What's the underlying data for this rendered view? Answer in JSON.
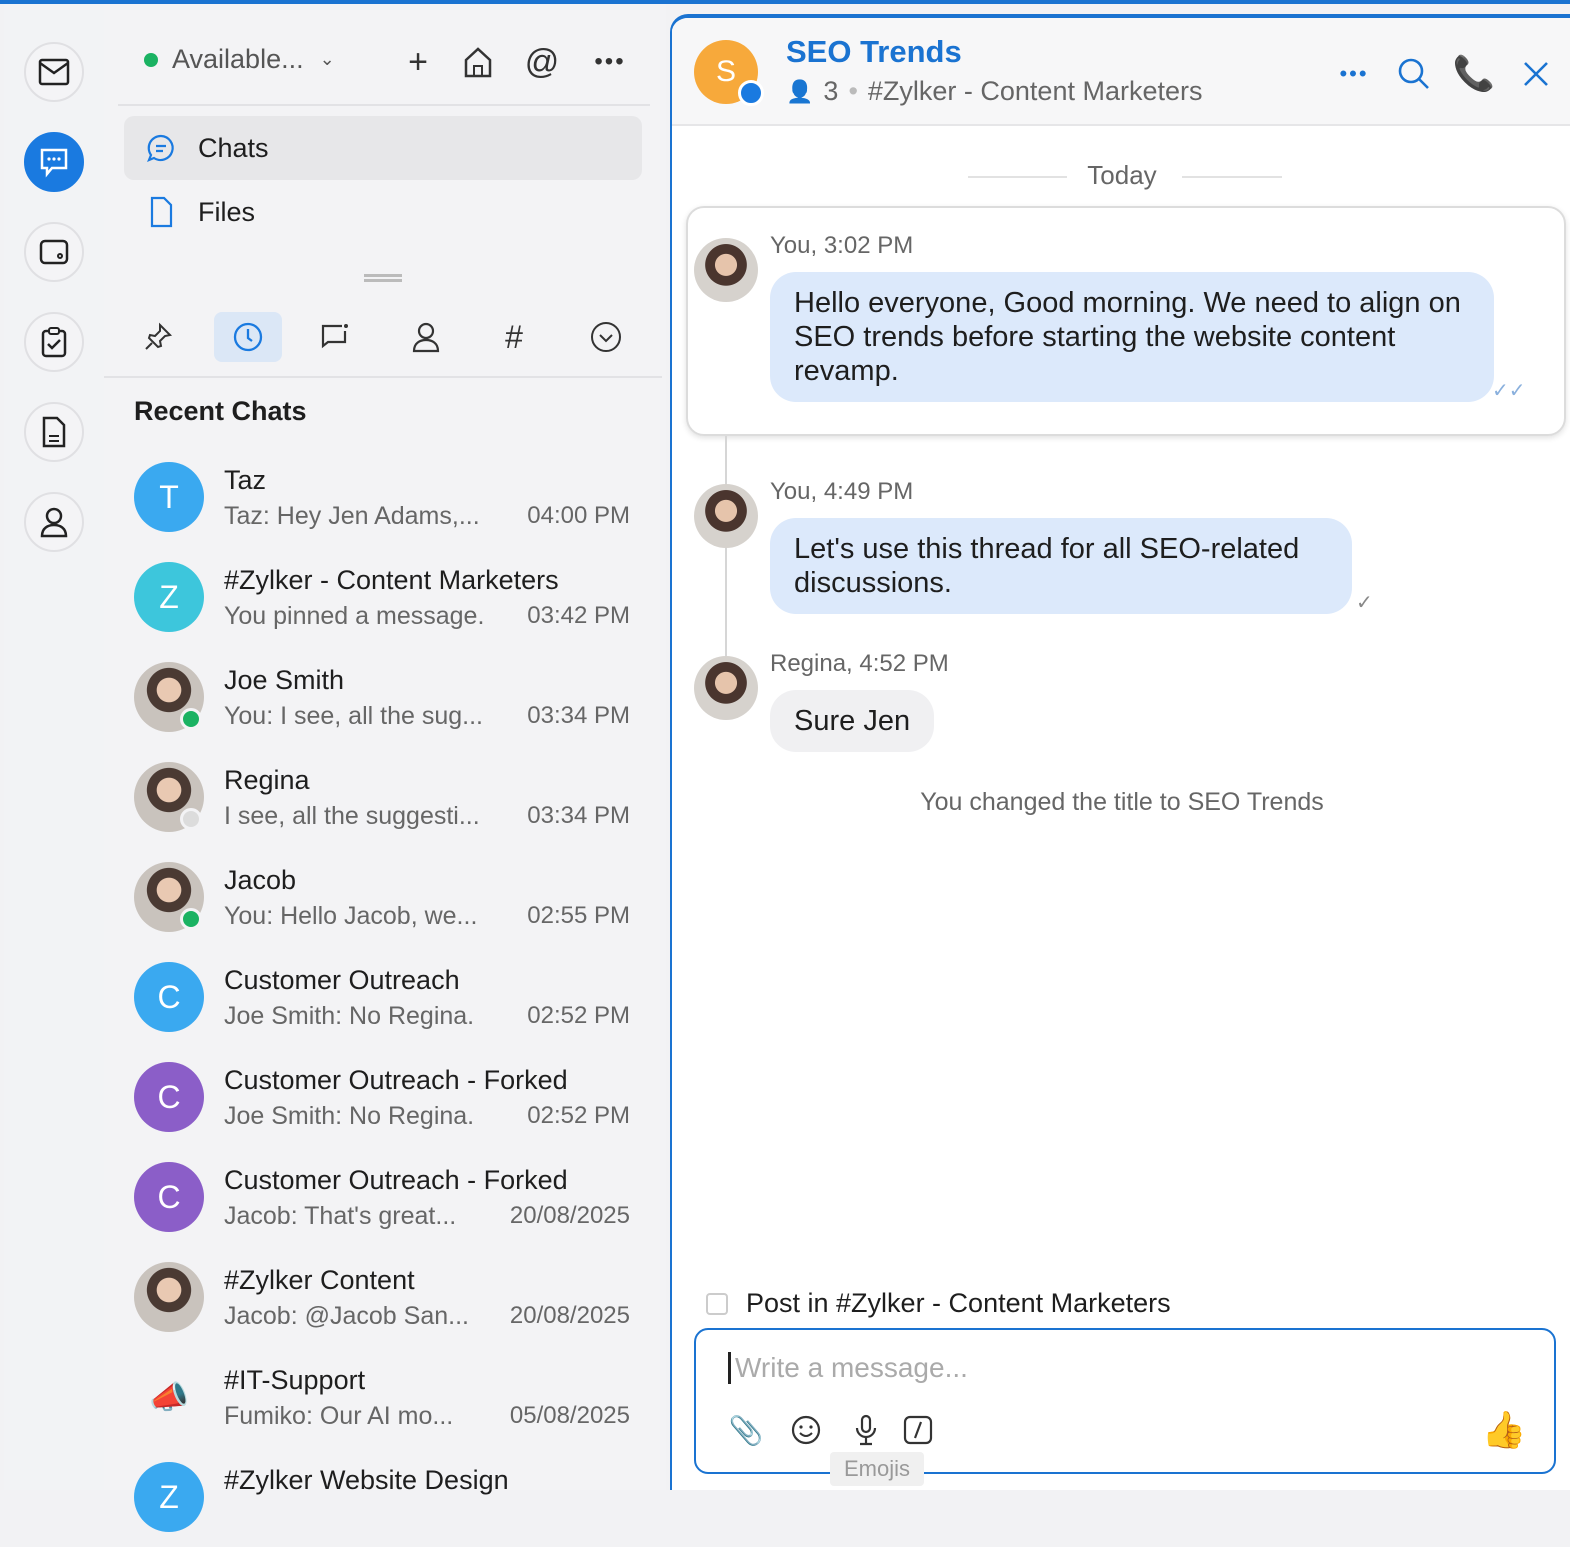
{
  "header": {
    "status": "Available..."
  },
  "nav": [
    {
      "label": "Chats"
    },
    {
      "label": "Files"
    }
  ],
  "recent_title": "Recent Chats",
  "chats": [
    {
      "initial": "T",
      "color": "#3aa9f0",
      "name": "Taz",
      "preview": "Taz: Hey Jen Adams,...",
      "time": "04:00 PM",
      "photo": false
    },
    {
      "initial": "Z",
      "color": "#3dc6dc",
      "name": "#Zylker - Content Marketers",
      "preview": "You pinned a message.",
      "time": "03:42 PM",
      "photo": false
    },
    {
      "initial": "",
      "color": "",
      "name": "Joe Smith",
      "preview": "You: I see, all the sug...",
      "time": "03:34 PM",
      "photo": true,
      "presence": "#1ab262"
    },
    {
      "initial": "",
      "color": "",
      "name": "Regina",
      "preview": "I see, all the suggesti...",
      "time": "03:34 PM",
      "photo": true,
      "presence": "#dcdcdc"
    },
    {
      "initial": "",
      "color": "",
      "name": "Jacob",
      "preview": "You: Hello Jacob, we...",
      "time": "02:55 PM",
      "photo": true,
      "presence": "#1ab262"
    },
    {
      "initial": "C",
      "color": "#3aa9f0",
      "name": "Customer Outreach",
      "preview": "Joe Smith: No Regina.",
      "time": "02:52 PM",
      "photo": false
    },
    {
      "initial": "C",
      "color": "#8b5ec8",
      "name": "Customer Outreach - Forked",
      "preview": "Joe Smith: No Regina.",
      "time": "02:52 PM",
      "photo": false
    },
    {
      "initial": "C",
      "color": "#8b5ec8",
      "name": "Customer Outreach - Forked",
      "preview": "Jacob: That's great...",
      "time": "20/08/2025",
      "photo": false
    },
    {
      "initial": "",
      "color": "#d0643c",
      "name": "#Zylker Content",
      "preview": "Jacob: @Jacob San...",
      "time": "20/08/2025",
      "photo": true
    },
    {
      "initial": "📣",
      "color": "#f3f3f5",
      "name": "#IT-Support",
      "preview": "Fumiko: Our AI mo...",
      "time": "05/08/2025",
      "photo": false
    },
    {
      "initial": "Z",
      "color": "#3aa9f0",
      "name": "#Zylker Website Design",
      "preview": "",
      "time": "",
      "photo": false
    }
  ],
  "chat": {
    "avatar_initial": "S",
    "title": "SEO Trends",
    "members": "3",
    "channel": "#Zylker - Content Marketers",
    "date_divider": "Today",
    "messages": [
      {
        "meta": "You, 3:02 PM",
        "text": "Hello everyone, Good morning. We need to align on SEO trends before starting the website content revamp."
      },
      {
        "meta": "You, 4:49 PM",
        "text": "Let's use this thread for all SEO-related discussions."
      },
      {
        "meta": "Regina, 4:52 PM",
        "text": "Sure Jen"
      }
    ],
    "system": "You changed the title to SEO Trends",
    "post_in": "Post in #Zylker - Content Marketers",
    "placeholder": "Write a message...",
    "tooltip": "Emojis"
  },
  "colors": {
    "accent": "#1a73d1",
    "online": "#1ab262"
  }
}
